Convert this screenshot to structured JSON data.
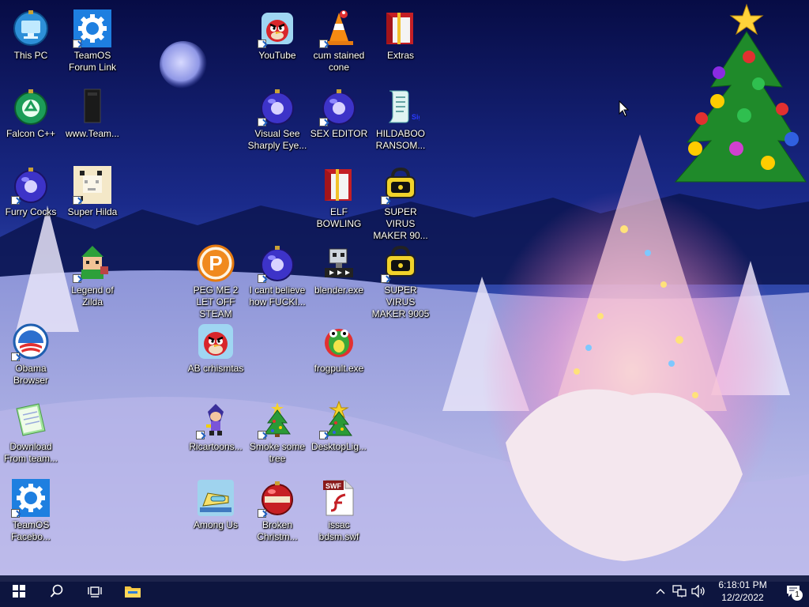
{
  "desktop": {
    "icons": [
      {
        "label": "This PC",
        "icon": "computer-icon",
        "shortcut": false
      },
      {
        "label": "TeamOS Forum Link",
        "icon": "gear-icon",
        "shortcut": true
      },
      {
        "label": "Falcon C++",
        "icon": "recycle-orb-icon",
        "shortcut": false
      },
      {
        "label": "www.Team...",
        "icon": "dark-box-icon",
        "shortcut": false
      },
      {
        "label": "Furry Cocks",
        "icon": "purple-orb-icon",
        "shortcut": true
      },
      {
        "label": "Super Hilda",
        "icon": "pixel-character-icon",
        "shortcut": true
      },
      {
        "label": "Legend of Zilda",
        "icon": "pixel-elf-icon",
        "shortcut": true
      },
      {
        "label": "Obama Browser",
        "icon": "obama-logo-icon",
        "shortcut": true
      },
      {
        "label": "Download From team...",
        "icon": "notepad-icon",
        "shortcut": false
      },
      {
        "label": "TeamOS Facebo...",
        "icon": "gear-icon",
        "shortcut": true
      },
      {
        "label": "PEG ME 2 LET OFF STEAM",
        "icon": "peggle-icon",
        "shortcut": false
      },
      {
        "label": "AB crhismtas",
        "icon": "angry-bird-icon",
        "shortcut": false
      },
      {
        "label": "Ricartoons...",
        "icon": "cartoon-character-icon",
        "shortcut": true
      },
      {
        "label": "Among Us",
        "icon": "among-us-icon",
        "shortcut": false
      },
      {
        "label": "YouTube",
        "icon": "angry-bird-icon",
        "shortcut": true
      },
      {
        "label": "Visual See Sharply Eye...",
        "icon": "purple-orb-icon",
        "shortcut": true
      },
      {
        "label": "I cant believe how FUCKI...",
        "icon": "purple-orb-icon",
        "shortcut": true
      },
      {
        "label": "Smoke some tree",
        "icon": "christmas-tree-icon",
        "shortcut": true
      },
      {
        "label": "Broken Christm...",
        "icon": "christmas-ornament-icon",
        "shortcut": true
      },
      {
        "label": "cum stained cone",
        "icon": "traffic-cone-icon",
        "shortcut": true
      },
      {
        "label": "SEX EDITOR",
        "icon": "purple-orb-icon",
        "shortcut": true
      },
      {
        "label": "ELF BOWLING",
        "icon": "gift-box-icon",
        "shortcut": false
      },
      {
        "label": "blender.exe",
        "icon": "blender-robot-icon",
        "shortcut": false
      },
      {
        "label": "frogpult.exe",
        "icon": "frog-icon",
        "shortcut": false
      },
      {
        "label": "DesktopLig...",
        "icon": "christmas-tree-icon",
        "shortcut": true
      },
      {
        "label": "issac bdsm.swf",
        "icon": "flash-file-icon",
        "shortcut": false
      },
      {
        "label": "Extras",
        "icon": "gift-box-icon",
        "shortcut": false
      },
      {
        "label": "HILDABOO RANSOM...",
        "icon": "script-scroll-icon",
        "shortcut": false
      },
      {
        "label": "SUPER VIRUS MAKER 90...",
        "icon": "lock-vault-icon",
        "shortcut": true
      },
      {
        "label": "SUPER VIRUS MAKER 9005",
        "icon": "lock-vault-icon",
        "shortcut": true
      }
    ]
  },
  "taskbar": {
    "start_icon": "windows-logo-icon",
    "search_icon": "search-icon",
    "task_view_icon": "task-view-icon",
    "pinned": [
      {
        "name": "file-explorer",
        "icon": "folder-icon"
      }
    ],
    "tray": {
      "chevron_icon": "chevron-up-icon",
      "network_icon": "network-icon",
      "volume_icon": "speaker-icon",
      "time": "6:18:01 PM",
      "date": "12/2/2022",
      "notifications_icon": "action-center-icon",
      "notifications_count": "1"
    },
    "color": "#0e163e"
  },
  "colors": {
    "sky_top": "#0a0f4a",
    "sky_bottom": "#3b55b5",
    "snow": "#cfd3f0",
    "label_text": "#ffffff"
  }
}
